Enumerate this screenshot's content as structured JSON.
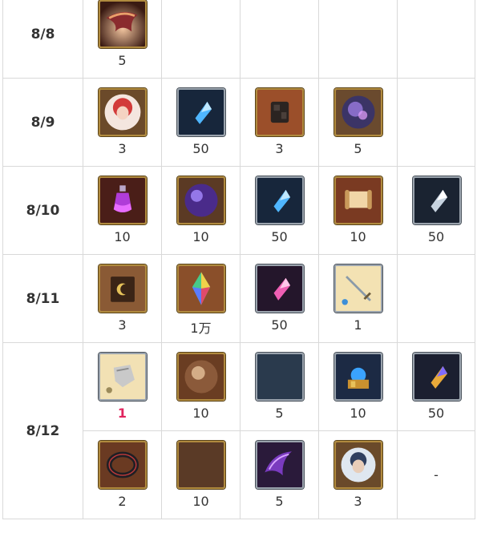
{
  "rows": [
    {
      "date": "8/8",
      "lines": [
        [
          {
            "icon": "horn-icon",
            "qty": "5"
          }
        ]
      ]
    },
    {
      "date": "8/9",
      "lines": [
        [
          {
            "icon": "red-hair-character-orb-icon",
            "qty": "3"
          },
          {
            "icon": "blue-crystal-shard-icon",
            "qty": "50"
          },
          {
            "icon": "dark-ore-icon",
            "qty": "3"
          },
          {
            "icon": "cosmic-orb-icon",
            "qty": "5"
          }
        ]
      ]
    },
    {
      "date": "8/10",
      "lines": [
        [
          {
            "icon": "purple-potion-icon",
            "qty": "10"
          },
          {
            "icon": "purple-orb-icon",
            "qty": "10"
          },
          {
            "icon": "blue-crystal-shard-icon",
            "qty": "50"
          },
          {
            "icon": "scroll-icon",
            "qty": "10"
          },
          {
            "icon": "silver-crystal-shard-icon",
            "qty": "50"
          }
        ]
      ]
    },
    {
      "date": "8/11",
      "lines": [
        [
          {
            "icon": "moon-tome-icon",
            "qty": "3"
          },
          {
            "icon": "rainbow-crystal-icon",
            "qty": "1万"
          },
          {
            "icon": "pink-crystal-shard-icon",
            "qty": "50"
          },
          {
            "icon": "sword-weapon-icon",
            "qty": "1"
          }
        ]
      ]
    },
    {
      "date": "8/12",
      "lines": [
        [
          {
            "icon": "gauntlet-weapon-icon",
            "qty": "1",
            "highlight": "red"
          },
          {
            "icon": "amber-orb-icon",
            "qty": "10"
          },
          {
            "icon": "silver-crescent-moon-icon",
            "qty": "5"
          },
          {
            "icon": "golden-treasure-icon",
            "qty": "10"
          },
          {
            "icon": "gold-crystal-shard-icon",
            "qty": "50"
          }
        ],
        [
          {
            "icon": "black-ring-icon",
            "qty": "2"
          },
          {
            "icon": "bronze-crescent-moon-icon",
            "qty": "10"
          },
          {
            "icon": "dark-horn-icon",
            "qty": "5"
          },
          {
            "icon": "dark-character-orb-icon",
            "qty": "3"
          },
          {
            "dash": "-"
          }
        ]
      ]
    }
  ]
}
